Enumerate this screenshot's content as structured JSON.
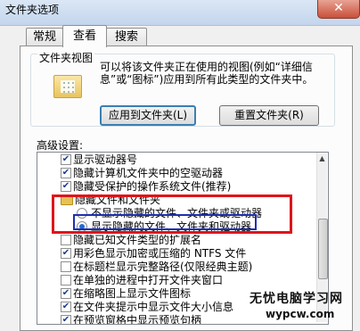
{
  "window": {
    "title": "文件夹选项",
    "close_glyph": "✕"
  },
  "tabs": [
    {
      "label": "常规"
    },
    {
      "label": "查看"
    },
    {
      "label": "搜索"
    }
  ],
  "folder_views": {
    "group_label": "文件夹视图",
    "description": "可以将该文件夹正在使用的视图(例如“详细信息”或“图标”)应用到所有此类型的文件夹中。",
    "apply_button": "应用到文件夹(L)",
    "reset_button": "重置文件夹(R)"
  },
  "advanced": {
    "label": "高级设置:",
    "items": [
      {
        "text": "显示驱动器号",
        "checked": true
      },
      {
        "text": "隐藏计算机文件夹中的空驱动器",
        "checked": true
      },
      {
        "text": "隐藏受保护的操作系统文件(推荐)",
        "checked": true
      },
      {
        "text": "隐藏文件和文件夹"
      },
      {
        "text": "不显示隐藏的文件、文件夹或驱动器",
        "selected": false
      },
      {
        "text": "显示隐藏的文件、文件夹和驱动器",
        "selected": true
      },
      {
        "text": "隐藏已知文件类型的扩展名",
        "checked": false
      },
      {
        "text": "用彩色显示加密或压缩的 NTFS 文件",
        "checked": true
      },
      {
        "text": "在标题栏显示完整路径(仅限经典主题)",
        "checked": false
      },
      {
        "text": "在单独的进程中打开文件夹窗口",
        "checked": false
      },
      {
        "text": "在缩略图上显示文件图标",
        "checked": true
      },
      {
        "text": "在文件夹提示中显示文件大小信息",
        "checked": true
      },
      {
        "text": "在预览窗格中显示预览句柄",
        "checked": true
      }
    ]
  },
  "scroll": {
    "up_glyph": "▲"
  },
  "watermark": {
    "line1": "无忧电脑学习网",
    "line2": "wypcw.com"
  },
  "colors": {
    "highlight_red": "#e0141a",
    "highlight_blue": "#1e2fb0"
  }
}
